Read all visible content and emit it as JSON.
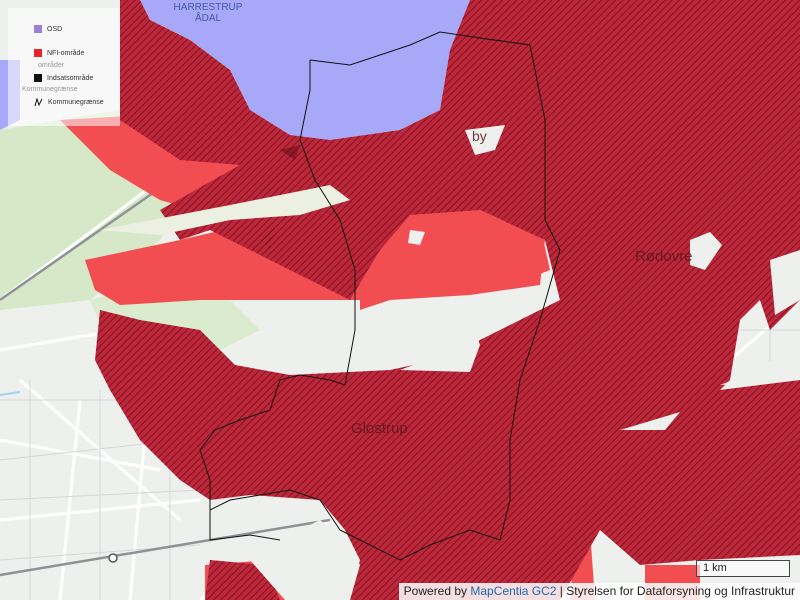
{
  "map": {
    "colors": {
      "base": "#eef0ee",
      "green": "#d6e8c8",
      "road": "#ffffff",
      "red_fill": "#f24e52",
      "red_hatched": "#c0263a",
      "osd_blue": "#a7a8f8",
      "water": "#9fd4f0"
    },
    "places": [
      {
        "key": "glostrup",
        "label": "Glostrup"
      },
      {
        "key": "rodovre",
        "label": "Rødovre"
      },
      {
        "key": "by",
        "label": "by"
      },
      {
        "key": "harrestrup",
        "label": "HARRESTRUP ÅDAL"
      }
    ]
  },
  "legend": {
    "items": [
      {
        "label": "OSD",
        "color": "#9b7fd8",
        "icon": "square-swatch"
      },
      {
        "label": "NFI-område",
        "color": "#e8232b",
        "icon": "square-swatch"
      },
      {
        "label": "Indsatsområde",
        "color": "#111111",
        "icon": "square-swatch"
      },
      {
        "label": "Kommunegrænse",
        "color": "#111111",
        "icon": "boundary-line-icon"
      }
    ],
    "ghost_labels": [
      "Kommunegrænse",
      "områder"
    ]
  },
  "scale": {
    "label": "1 km"
  },
  "attribution": {
    "prefix": "Powered by",
    "link": "MapCentia GC2",
    "suffix": "| Styrelsen for Dataforsyning og Infrastruktur"
  }
}
